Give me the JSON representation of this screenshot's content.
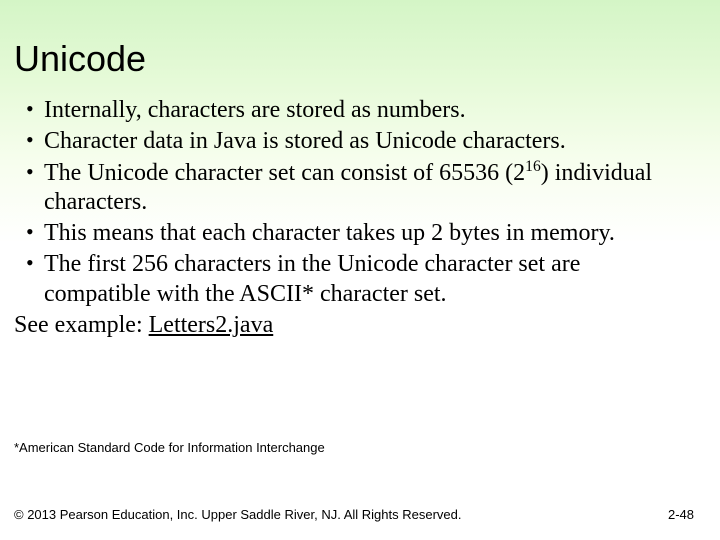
{
  "title": "Unicode",
  "bullets": [
    "Internally, characters are stored as numbers.",
    "Character data in Java is stored as Unicode characters.",
    "The Unicode character set can consist of 65536 (2^16) individual characters.",
    "This means that each character takes up 2 bytes in memory.",
    "The first 256 characters in the Unicode character set are compatible with the ASCII* character set."
  ],
  "see_example_label": "See example: ",
  "see_example_link": "Letters2.java",
  "footnote": "*American Standard Code for Information Interchange",
  "footer_left": "© 2013 Pearson Education, Inc. Upper Saddle River, NJ. All Rights Reserved.",
  "footer_right": "2-48"
}
